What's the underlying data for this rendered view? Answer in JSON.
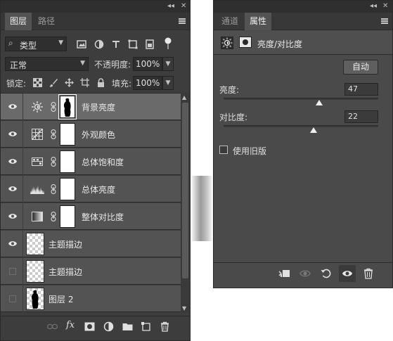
{
  "layers_panel": {
    "tabs": [
      "图层",
      "路径"
    ],
    "filter": {
      "label": "类型"
    },
    "blend_mode": "正常",
    "opacity_label": "不透明度:",
    "opacity_value": "100%",
    "lock_label": "锁定:",
    "fill_label": "填充:",
    "fill_value": "100%",
    "layers": [
      {
        "name": "背景亮度",
        "kind": "adjustment",
        "icon": "sun-icon",
        "visible": true,
        "selected": true,
        "mask": "silhouette"
      },
      {
        "name": "外观颜色",
        "kind": "adjustment",
        "icon": "color-lookup-icon",
        "visible": true,
        "selected": false,
        "mask": "white"
      },
      {
        "name": "总体饱和度",
        "kind": "adjustment",
        "icon": "hue-saturation-icon",
        "visible": true,
        "selected": false,
        "mask": "white"
      },
      {
        "name": "总体亮度",
        "kind": "adjustment",
        "icon": "levels-icon",
        "visible": true,
        "selected": false,
        "mask": "white"
      },
      {
        "name": "整体对比度",
        "kind": "adjustment",
        "icon": "gradient-map-icon",
        "visible": true,
        "selected": false,
        "mask": "white"
      },
      {
        "name": "主题描边",
        "kind": "pixel",
        "visible": true,
        "selected": false
      },
      {
        "name": "主题描边",
        "kind": "pixel",
        "visible": false,
        "selected": false
      },
      {
        "name": "图层 2",
        "kind": "pixel-silhouette",
        "visible": false,
        "selected": false
      }
    ]
  },
  "properties_panel": {
    "tabs": [
      "通道",
      "属性"
    ],
    "title": "亮度/对比度",
    "auto_button": "自动",
    "brightness": {
      "label": "亮度:",
      "value": "47",
      "fraction": 0.62
    },
    "contrast": {
      "label": "对比度:",
      "value": "22",
      "fraction": 0.58
    },
    "legacy_label": "使用旧版",
    "legacy_checked": false
  }
}
